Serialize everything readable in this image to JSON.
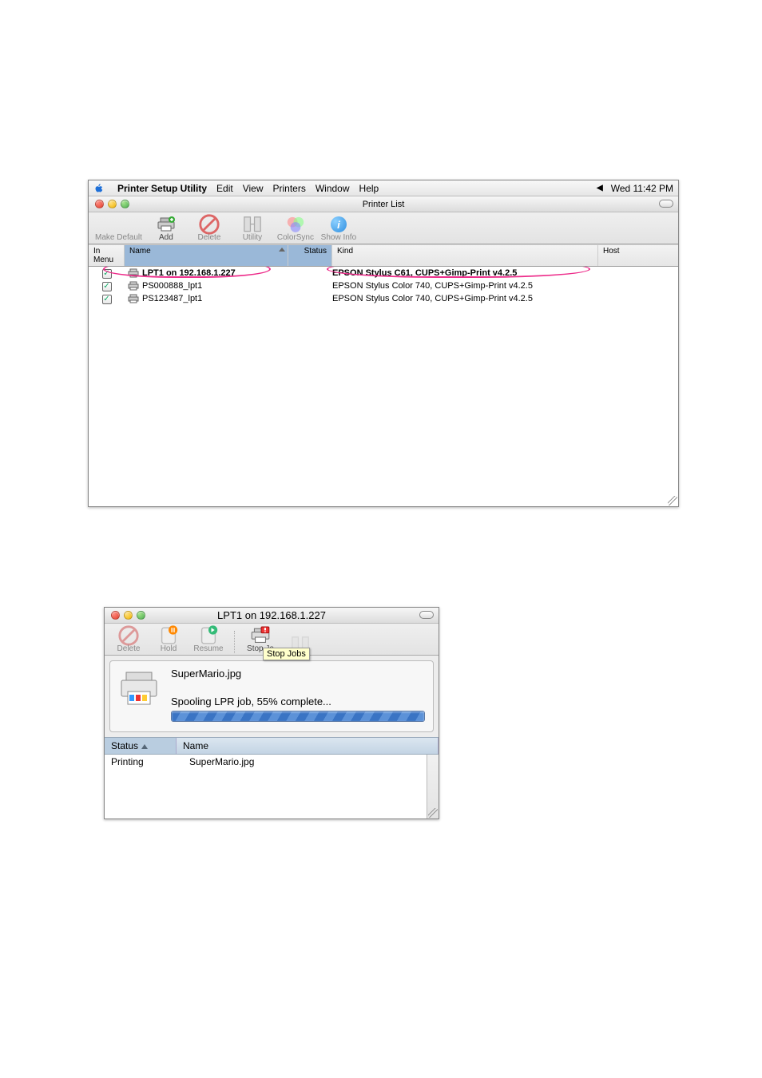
{
  "menubar": {
    "app": "Printer Setup Utility",
    "items": [
      "Edit",
      "View",
      "Printers",
      "Window",
      "Help"
    ],
    "clock": "Wed 11:42 PM"
  },
  "win1": {
    "title": "Printer List",
    "toolbar": {
      "make_default": "Make Default",
      "add": "Add",
      "delete": "Delete",
      "utility": "Utility",
      "colorsync": "ColorSync",
      "show_info": "Show Info"
    },
    "columns": {
      "in_menu": "In Menu",
      "name": "Name",
      "status": "Status",
      "kind": "Kind",
      "host": "Host"
    },
    "printers": [
      {
        "in_menu": true,
        "name": "LPT1 on 192.168.1.227",
        "kind": "EPSON Stylus C61, CUPS+Gimp-Print v4.2.5",
        "bold": true
      },
      {
        "in_menu": true,
        "name": "PS000888_lpt1",
        "kind": "EPSON Stylus Color 740, CUPS+Gimp-Print v4.2.5",
        "bold": false
      },
      {
        "in_menu": true,
        "name": "PS123487_lpt1",
        "kind": "EPSON Stylus Color 740, CUPS+Gimp-Print v4.2.5",
        "bold": false
      }
    ]
  },
  "win2": {
    "title": "LPT1 on 192.168.1.227",
    "toolbar": {
      "delete": "Delete",
      "hold": "Hold",
      "resume": "Resume",
      "stop_jobs": "Stop Jobs",
      "tooltip": "Stop Jobs",
      "stop_partial": "Stop Jo"
    },
    "current_job": {
      "name": "SuperMario.jpg",
      "status_line": "Spooling LPR job, 55% complete...",
      "progress_percent": 55
    },
    "columns": {
      "status": "Status",
      "name": "Name"
    },
    "jobs": [
      {
        "status": "Printing",
        "name": "SuperMario.jpg"
      }
    ]
  }
}
